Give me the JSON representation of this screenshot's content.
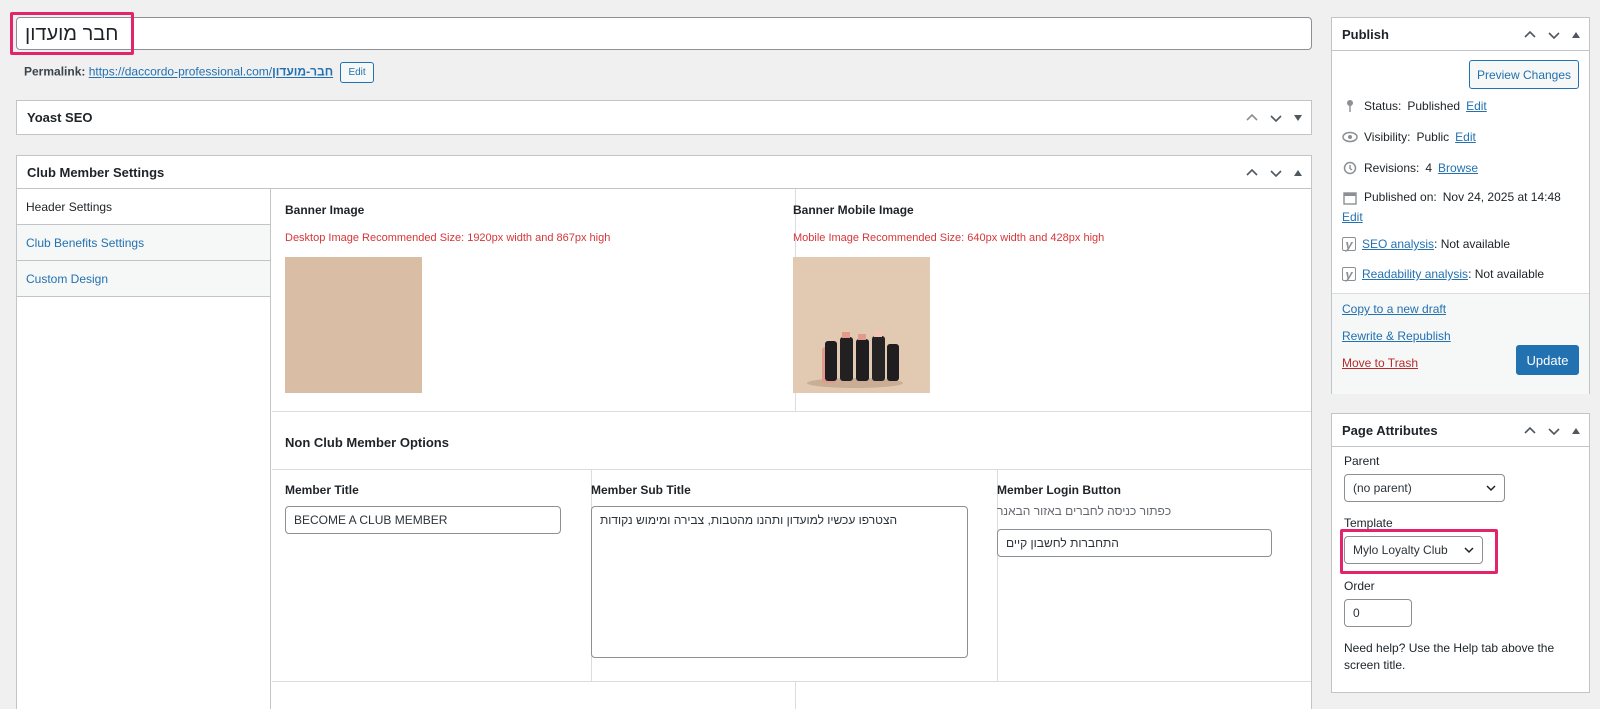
{
  "title": {
    "value": "חבר מועדון"
  },
  "permalink": {
    "label": "Permalink:",
    "base": "https://daccordo-professional.com/",
    "slug": "חבר-מועדון",
    "edit_label": "Edit"
  },
  "yoast": {
    "title": "Yoast SEO"
  },
  "club": {
    "title": "Club Member Settings",
    "tabs": [
      "Header Settings",
      "Club Benefits Settings",
      "Custom Design"
    ],
    "banner_image": {
      "label": "Banner Image",
      "note": "Desktop Image Recommended Size: 1920px width and 867px high"
    },
    "banner_mobile": {
      "label": "Banner Mobile Image",
      "note": "Mobile Image Recommended Size: 640px width and 428px high"
    },
    "non_member_heading": "Non Club Member Options",
    "member_title": {
      "label": "Member Title",
      "value": "BECOME A CLUB MEMBER"
    },
    "member_sub_title": {
      "label": "Member Sub Title",
      "value": "הצטרפו עכשיו למועדון ותהנו מהטבות, צבירה ומימוש נקודות"
    },
    "member_login": {
      "label": "Member Login Button",
      "description": "כפתור כניסה לחברים באזור הבאנר",
      "value": "התחברות לחשבון קיים"
    }
  },
  "publish": {
    "title": "Publish",
    "preview_label": "Preview Changes",
    "status_label": "Status:",
    "status_value": "Published",
    "status_edit": "Edit",
    "visibility_label": "Visibility:",
    "visibility_value": "Public",
    "visibility_edit": "Edit",
    "revisions_label": "Revisions:",
    "revisions_value": "4",
    "revisions_link": "Browse",
    "published_label": "Published on:",
    "published_value": "Nov 24, 2025 at 14:48",
    "published_edit": "Edit",
    "seo_link": "SEO analysis",
    "seo_value": ": Not available",
    "readability_link": "Readability analysis",
    "readability_value": ": Not available",
    "copy_draft": "Copy to a new draft",
    "rewrite": "Rewrite & Republish",
    "trash": "Move to Trash",
    "update_label": "Update"
  },
  "page_attributes": {
    "title": "Page Attributes",
    "parent_label": "Parent",
    "parent_value": "(no parent)",
    "template_label": "Template",
    "template_value": "Mylo Loyalty Club",
    "order_label": "Order",
    "order_value": "0",
    "help_text": "Need help? Use the Help tab above the screen title."
  },
  "colors": {
    "accent": "#2271b1",
    "highlight": "#e2246b",
    "warning": "#d63638",
    "banner_bg": "#d9bea5"
  }
}
